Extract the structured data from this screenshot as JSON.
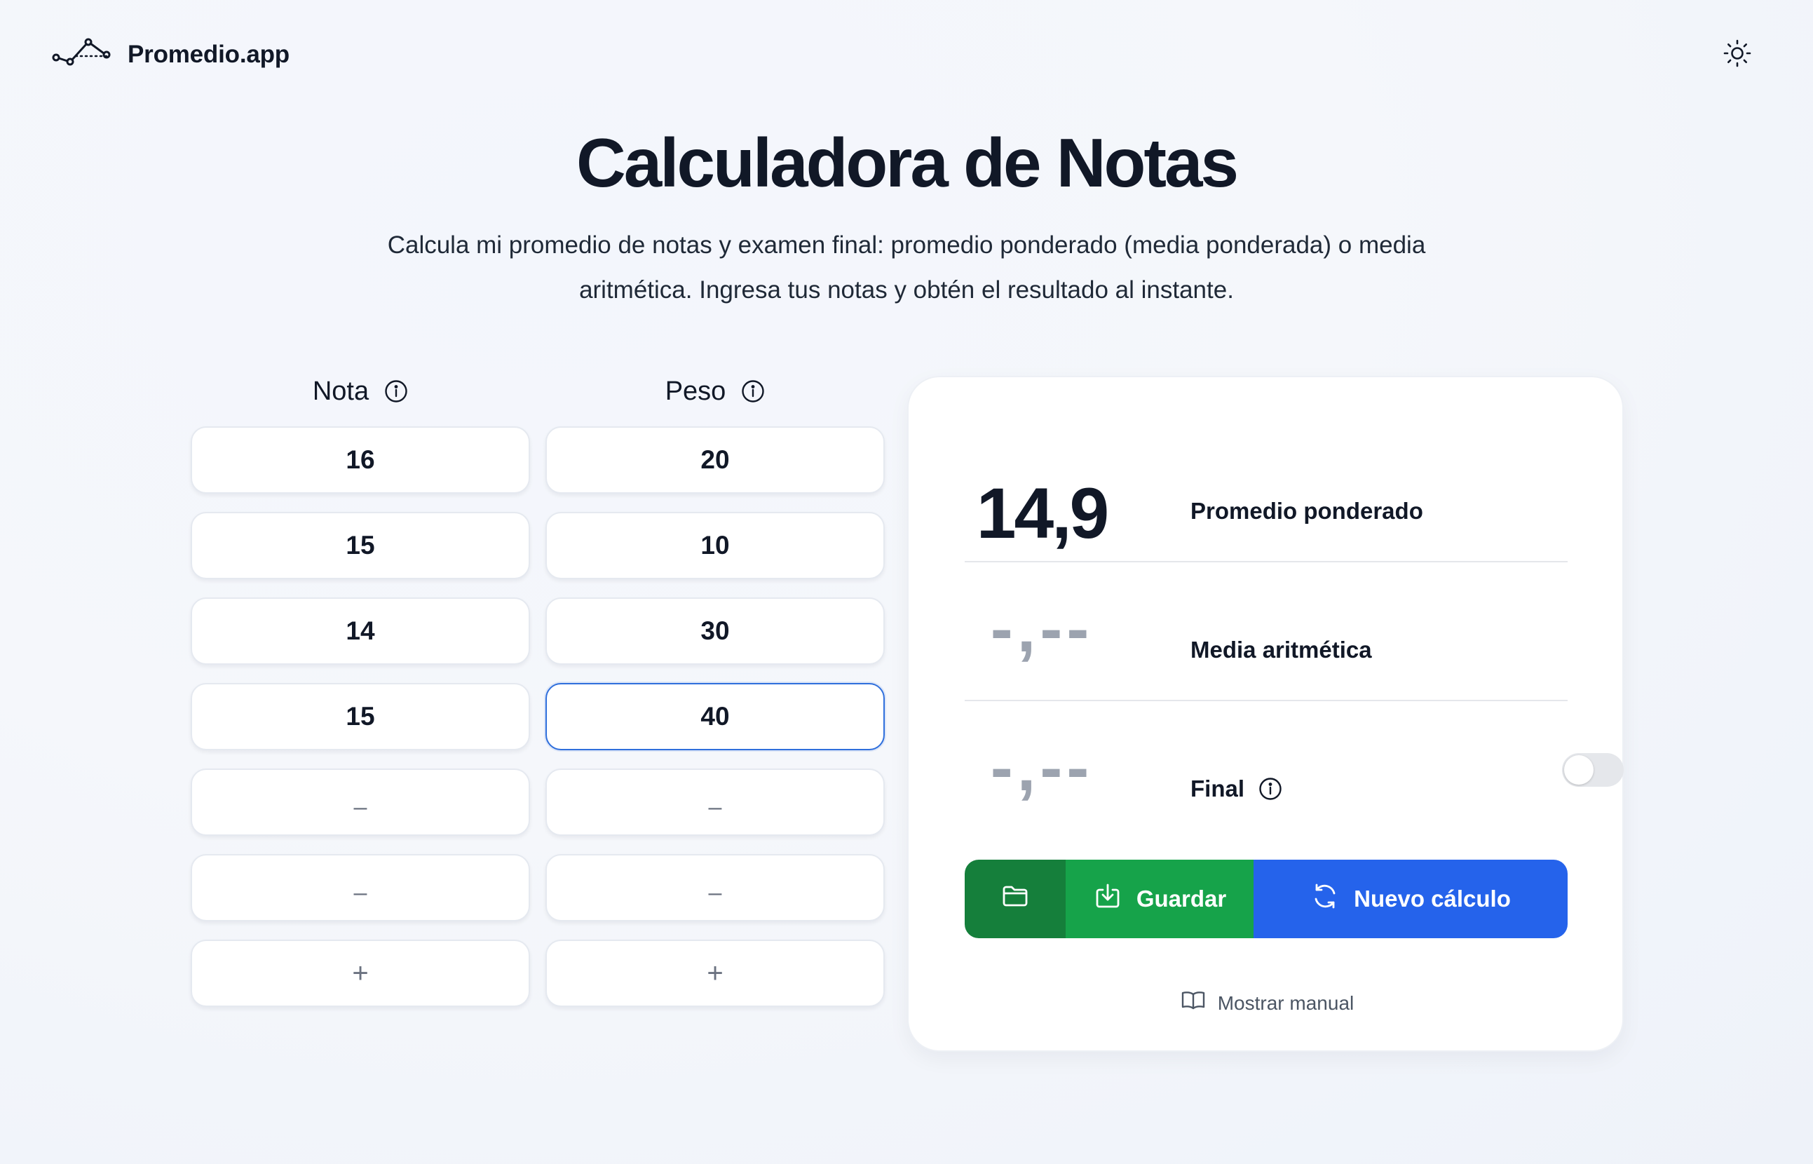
{
  "header": {
    "brand_name": "Promedio.app",
    "logo_icon": "line-chart-icon",
    "theme_icon": "sun-icon"
  },
  "hero": {
    "title": "Calculadora de Notas",
    "subtitle": "Calcula mi promedio de notas y examen final: promedio ponderado (media ponderada) o media aritmética. Ingresa tus notas y obtén el resultado al instante."
  },
  "table": {
    "nota_header": "Nota",
    "peso_header": "Peso",
    "rows": [
      {
        "nota": "16",
        "peso": "20"
      },
      {
        "nota": "15",
        "peso": "10"
      },
      {
        "nota": "14",
        "peso": "30"
      },
      {
        "nota": "15",
        "peso": "40"
      },
      {
        "nota": "–",
        "peso": "–"
      },
      {
        "nota": "–",
        "peso": "–"
      }
    ],
    "add_label": "+"
  },
  "results": {
    "weighted": {
      "value": "14,9",
      "label": "Promedio ponderado"
    },
    "arithmetic": {
      "value": "-,--",
      "label": "Media aritmética"
    },
    "final": {
      "value": "-,--",
      "label": "Final",
      "toggle_on": false
    }
  },
  "actions": {
    "folder_icon": "folder-icon",
    "save_label": "Guardar",
    "new_label": "Nuevo cálculo",
    "manual_label": "Mostrar manual"
  },
  "colors": {
    "green_dark": "#157f3b",
    "green": "#16a34a",
    "blue": "#2563eb",
    "focus": "#2f6fdc"
  }
}
